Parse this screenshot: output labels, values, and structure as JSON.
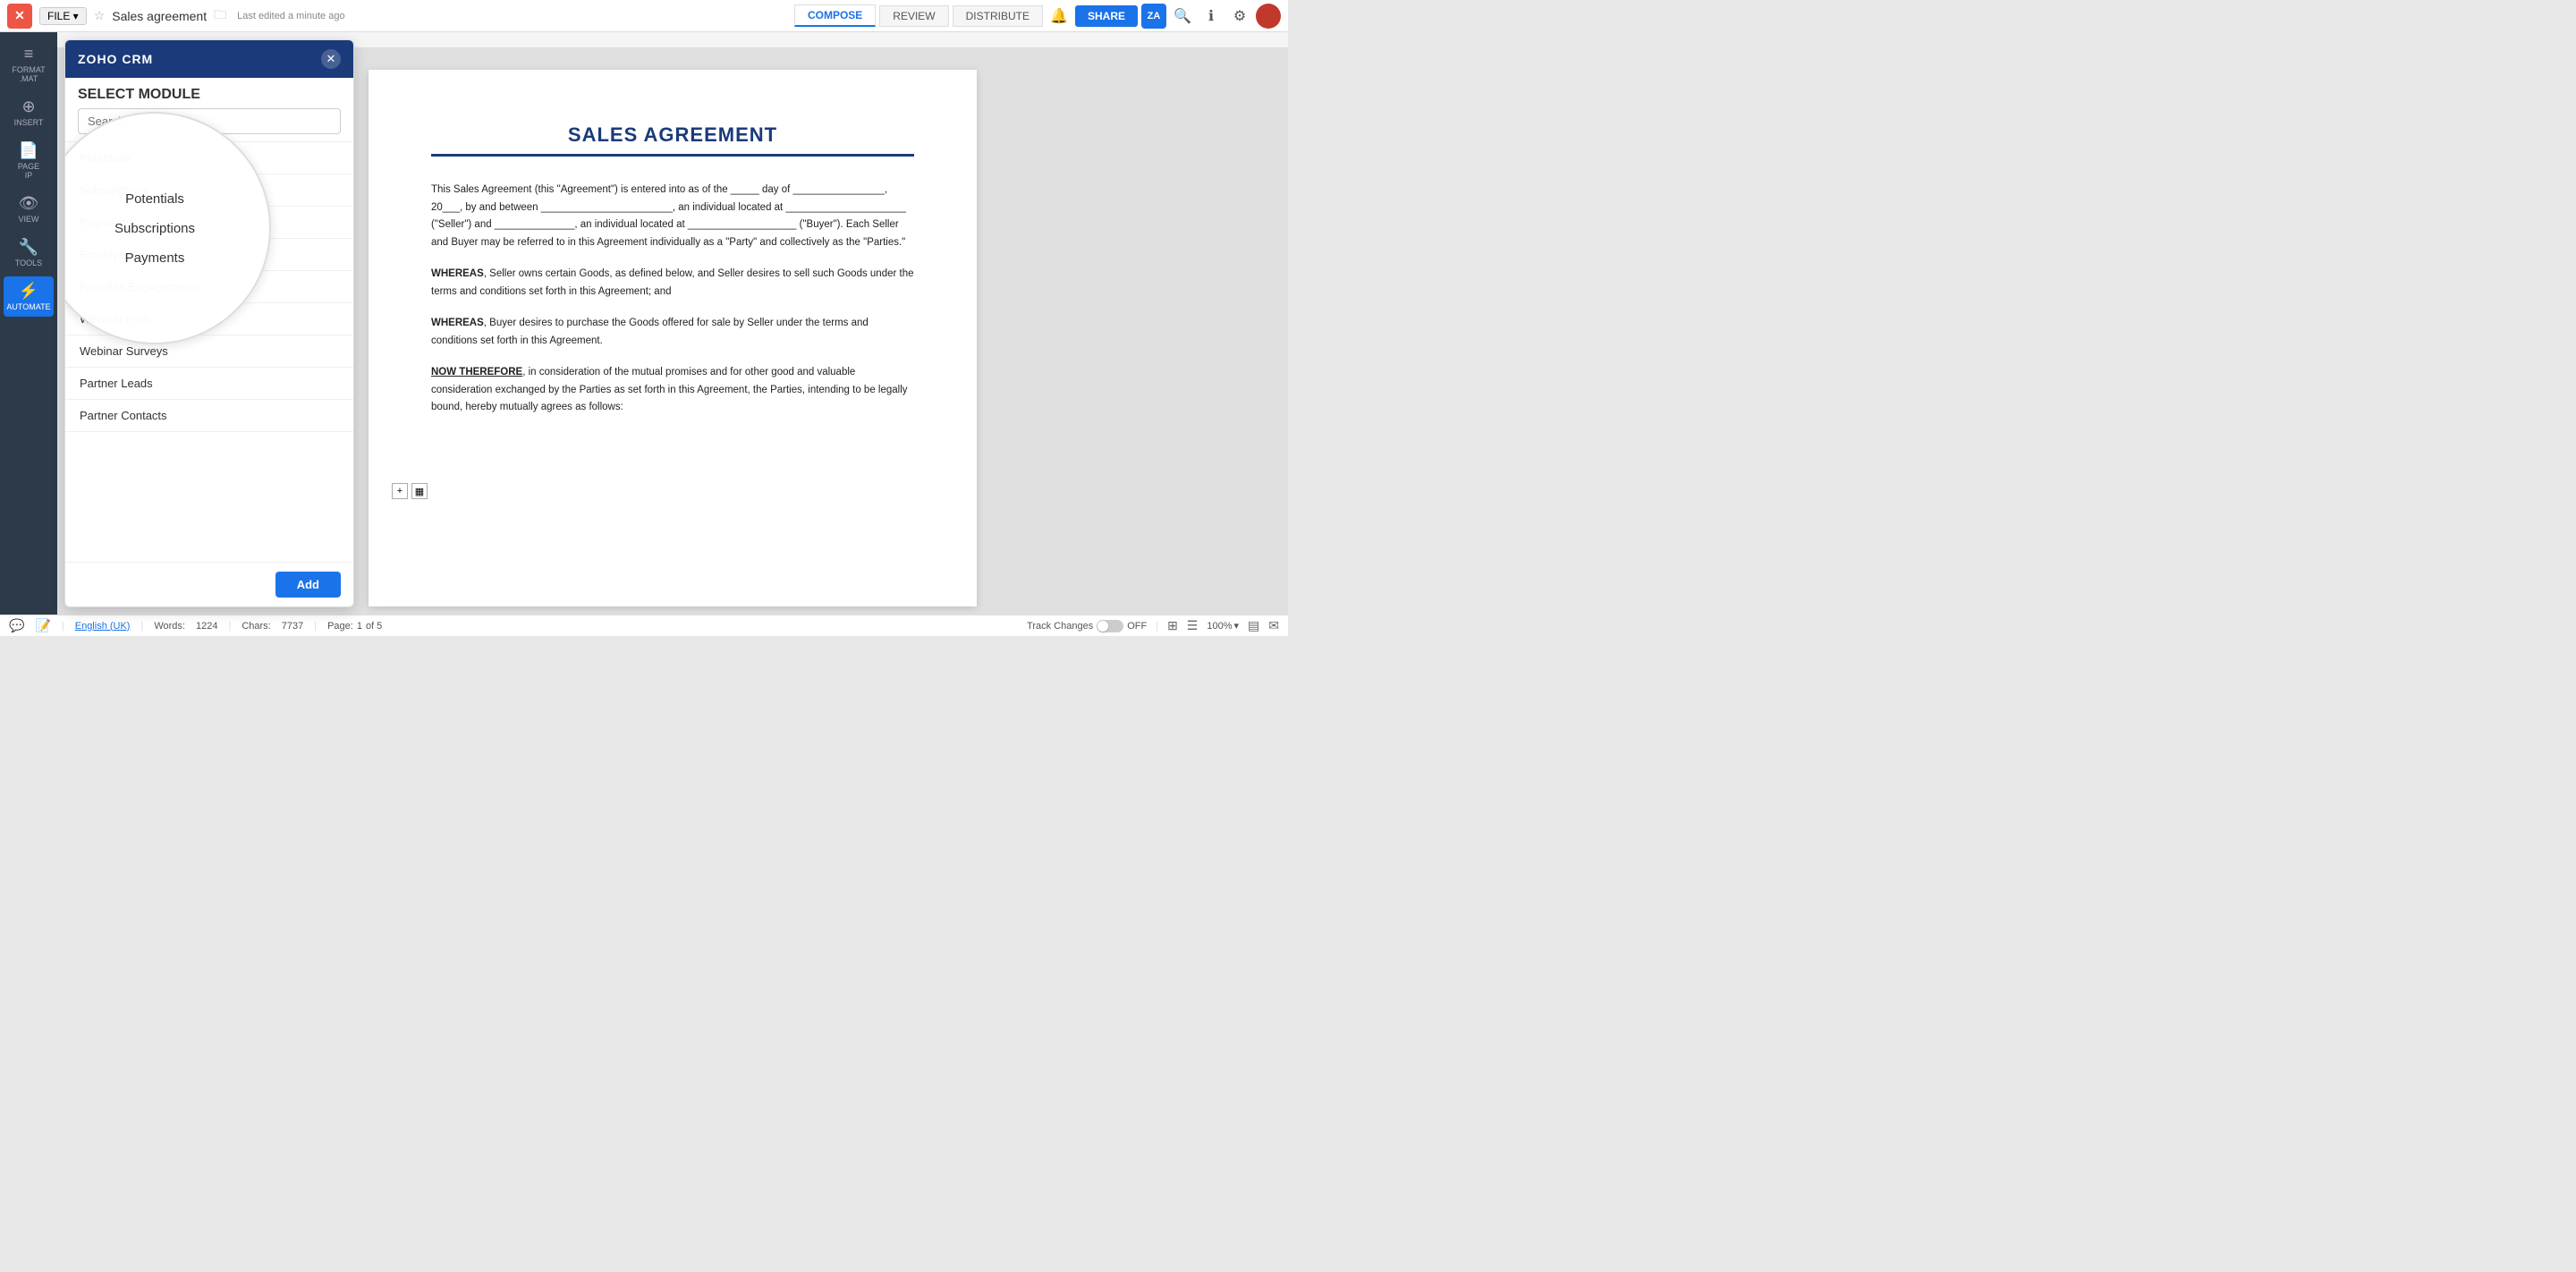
{
  "app": {
    "close_label": "✕",
    "file_label": "FILE ▾",
    "star_icon": "☆",
    "doc_title": "Sales agreement",
    "folder_icon": "🗀",
    "last_edited": "Last edited a minute ago",
    "tabs": [
      {
        "label": "COMPOSE",
        "active": true
      },
      {
        "label": "REVIEW",
        "active": false
      },
      {
        "label": "DISTRIBUTE",
        "active": false
      }
    ],
    "share_label": "SHARE",
    "za_badge": "ZA"
  },
  "sidebar": {
    "items": [
      {
        "label": "FORMAT\n.MAT",
        "icon": "≡",
        "active": false
      },
      {
        "label": "INSERT",
        "icon": "⊕",
        "active": false
      },
      {
        "label": "PAGE\nIP",
        "icon": "📄",
        "active": false
      },
      {
        "label": "VIEW",
        "icon": "👁",
        "active": false
      },
      {
        "label": "TOOLS",
        "icon": "🔧",
        "active": false
      },
      {
        "label": "AUTOMATE",
        "icon": "⚡",
        "active": true
      }
    ]
  },
  "crm_panel": {
    "logo": "ZOHO CRM",
    "close_icon": "✕",
    "select_module_label": "SELECT MODULE",
    "search_placeholder": "Search",
    "modules": [
      {
        "label": "Potentials",
        "highlighted": false
      },
      {
        "label": "Subscriptions",
        "highlighted": false
      },
      {
        "label": "Payments",
        "highlighted": false
      },
      {
        "label": "Employees",
        "highlighted": false
      },
      {
        "label": "Presales Engagements",
        "highlighted": false
      },
      {
        "label": "Webinar Polls",
        "highlighted": false
      },
      {
        "label": "Webinar Surveys",
        "highlighted": false
      },
      {
        "label": "Partner Leads",
        "highlighted": false
      },
      {
        "label": "Partner Contacts",
        "highlighted": false
      }
    ],
    "add_button_label": "Add"
  },
  "document": {
    "title": "SALES AGREEMENT",
    "paragraphs": [
      "This Sales Agreement (this “Agreement”) is entered into as of the _____ day of ________________, 20___, by and between _______________________, an individual located at _____________________ (“Seller”) and ______________, an individual located at ___________________ (“Buyer”). Each Seller and Buyer may be referred to in this Agreement individually as a “Party” and collectively as the “Parties.”",
      "WHEREAS, Seller owns certain Goods, as defined below, and Seller desires to sell such Goods under the terms and conditions set forth in this Agreement; and",
      "WHEREAS, Buyer desires to purchase the Goods offered for sale by Seller under the terms and conditions set forth in this Agreement.",
      "NOW THEREFORE, in consideration of the mutual promises and for other good and valuable consideration exchanged by the Parties as set forth in this Agreement, the Parties, intending to be legally bound, hereby mutually agrees as follows:"
    ]
  },
  "status_bar": {
    "comment_icon": "💬",
    "track_icon": "📝",
    "language": "English (UK)",
    "words_label": "Words:",
    "words_count": "1224",
    "chars_label": "Chars:",
    "chars_count": "7737",
    "page_label": "Page:",
    "page_current": "1",
    "page_of": "of 5",
    "track_changes_label": "Track Changes",
    "track_off": "OFF",
    "zoom_level": "100%"
  }
}
